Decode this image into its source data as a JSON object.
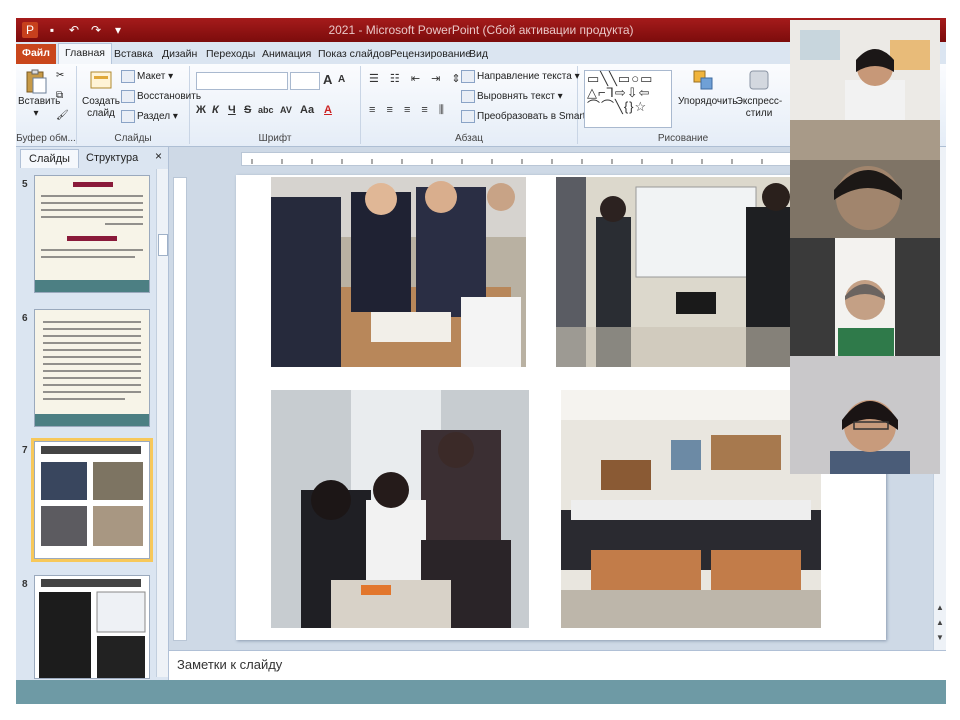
{
  "window": {
    "title": "2021 - Microsoft PowerPoint (Сбой активации продукта)"
  },
  "menu_tabs": [
    {
      "label": "Файл",
      "kind": "file"
    },
    {
      "label": "Главная",
      "kind": "active"
    },
    {
      "label": "Вставка",
      "kind": ""
    },
    {
      "label": "Дизайн",
      "kind": ""
    },
    {
      "label": "Переходы",
      "kind": ""
    },
    {
      "label": "Анимация",
      "kind": ""
    },
    {
      "label": "Показ слайдов",
      "kind": ""
    },
    {
      "label": "Рецензирование",
      "kind": ""
    },
    {
      "label": "Вид",
      "kind": ""
    }
  ],
  "ribbon": {
    "clipboard": {
      "paste": "Вставить",
      "group": "Буфер обм..."
    },
    "slides": {
      "create": "Создать слайд",
      "layout": "Макет",
      "reset": "Восстановить",
      "section": "Раздел",
      "group": "Слайды"
    },
    "font": {
      "group": "Шрифт",
      "bold": "Ж",
      "italic": "К",
      "underline": "Ч",
      "strike": "S",
      "shadow": "abc",
      "spacing": "AV",
      "case": "Aa",
      "grow": "A",
      "shrink": "A",
      "color": "A"
    },
    "paragraph": {
      "group": "Абзац",
      "direction": "Направление текста",
      "align": "Выровнять текст",
      "smartart": "Преобразовать в SmartArt"
    },
    "drawing": {
      "group": "Рисование",
      "arrange": "Упорядочить",
      "styles": "Экспресс-стили",
      "shapes": "▭╲╲▭○▭ △⌐⅂⇨⇩⇦ ⌒⌒╲{}☆"
    }
  },
  "panel": {
    "tab_slides": "Слайды",
    "tab_outline": "Структура",
    "close": "×",
    "slide_numbers": [
      "5",
      "6",
      "7",
      "8"
    ]
  },
  "notes": {
    "placeholder": "Заметки к слайду"
  },
  "colors": {
    "titlebar": "#8f1212",
    "file_tab": "#c9461c",
    "selection": "#f7c85a",
    "ribbon_bg": "#e5edf7"
  }
}
